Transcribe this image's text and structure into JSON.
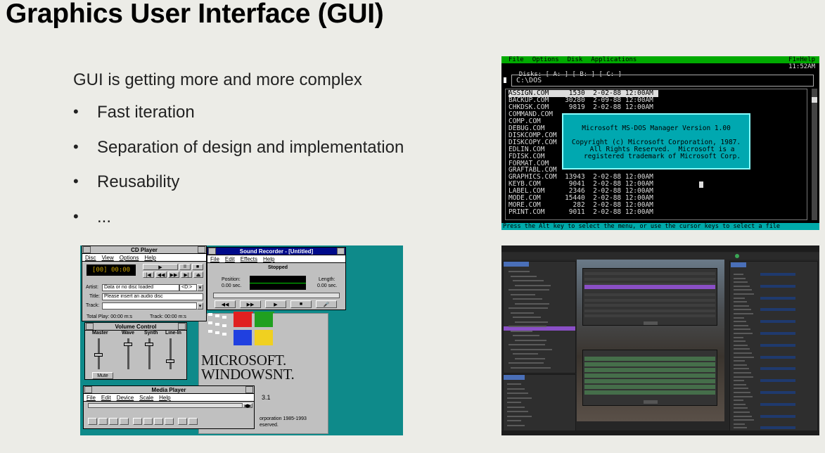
{
  "slide": {
    "title": "Graphics User Interface (GUI)",
    "intro": "GUI is getting more and more complex",
    "bullets": [
      "Fast iteration",
      "Separation of design and implementation",
      "Reusability",
      "..."
    ]
  },
  "win31": {
    "cd_player": {
      "title": "CD Player",
      "menu": [
        "Disc",
        "View",
        "Options",
        "Help"
      ],
      "display": "[00] 00:00",
      "artist_label": "Artist:",
      "artist_value": "Data or no disc loaded",
      "drive": "<D:>",
      "title_label": "Title:",
      "title_value": "Please insert an audio disc",
      "track_label": "Track:",
      "total_play": "Total Play: 00:00 m:s",
      "track_time": "Track: 00:00 m:s"
    },
    "sound_recorder": {
      "title": "Sound Recorder - [Untitled]",
      "menu": [
        "File",
        "Edit",
        "Effects",
        "Help"
      ],
      "status": "Stopped",
      "position_label": "Position:",
      "position_value": "0.00 sec.",
      "length_label": "Length:",
      "length_value": "0.00 sec.",
      "buttons": [
        "◀◀",
        "▶▶",
        "▶",
        "■",
        "🎤"
      ]
    },
    "volume_control": {
      "title": "Volume Control",
      "channels": [
        "Master",
        "Wave",
        "Synth",
        "Line-In"
      ],
      "levels": [
        0.45,
        0.85,
        0.85,
        0.2
      ],
      "mute_label": "Mute"
    },
    "media_player": {
      "title": "Media Player",
      "menu": [
        "File",
        "Edit",
        "Device",
        "Scale",
        "Help"
      ]
    },
    "logo": {
      "line1": "Microsoft.",
      "line2": "WindowsNT.",
      "version": "3.1",
      "copyright_1": "orporation 1985-1993",
      "copyright_2": "eserved."
    },
    "colors": {
      "desktop": "#0e8a8a",
      "titlebar_active": "#000a8a"
    }
  },
  "dos": {
    "menu": [
      "File",
      "Options",
      "Disk",
      "Applications"
    ],
    "help": "F1=Help",
    "disks": "Disks: [ A: ] [ B: ] [ C: ]",
    "clock": "11:52AM",
    "path": "C:\\DOS",
    "files": [
      {
        "name": "ASSIGN.COM",
        "size": "1530",
        "date": "2-02-88",
        "time": "12:00AM"
      },
      {
        "name": "BACKUP.COM",
        "size": "30280",
        "date": "2-09-88",
        "time": "12:00AM"
      },
      {
        "name": "CHKDSK.COM",
        "size": "9819",
        "date": "2-02-88",
        "time": "12:00AM"
      },
      {
        "name": "COMMAND.COM",
        "size": "",
        "date": "",
        "time": ""
      },
      {
        "name": "COMP.COM",
        "size": "",
        "date": "",
        "time": ""
      },
      {
        "name": "DEBUG.COM",
        "size": "",
        "date": "",
        "time": ""
      },
      {
        "name": "DISKCOMP.COM",
        "size": "",
        "date": "",
        "time": ""
      },
      {
        "name": "DISKCOPY.COM",
        "size": "",
        "date": "",
        "time": ""
      },
      {
        "name": "EDLIN.COM",
        "size": "",
        "date": "",
        "time": ""
      },
      {
        "name": "FDISK.COM",
        "size": "",
        "date": "",
        "time": ""
      },
      {
        "name": "FORMAT.COM",
        "size": "",
        "date": "",
        "time": ""
      },
      {
        "name": "GRAFTABL.COM",
        "size": "",
        "date": "",
        "time": ""
      },
      {
        "name": "GRAPHICS.COM",
        "size": "13943",
        "date": "2-02-88",
        "time": "12:00AM"
      },
      {
        "name": "KEYB.COM",
        "size": "9041",
        "date": "2-02-88",
        "time": "12:00AM"
      },
      {
        "name": "LABEL.COM",
        "size": "2346",
        "date": "2-02-88",
        "time": "12:00AM"
      },
      {
        "name": "MODE.COM",
        "size": "15440",
        "date": "2-02-88",
        "time": "12:00AM"
      },
      {
        "name": "MORE.COM",
        "size": "282",
        "date": "2-02-88",
        "time": "12:00AM"
      },
      {
        "name": "PRINT.COM",
        "size": "9011",
        "date": "2-02-88",
        "time": "12:00AM"
      }
    ],
    "dialog": {
      "title": "Microsoft MS-DOS Manager Version 1.00",
      "copyright": "Copyright (c) Microsoft Corporation, 1987.\n   All Rights Reserved.  Microsoft is a\n   registered trademark of Microsoft Corp."
    },
    "status": "Press the Alt key to select the menu, or use the cursor keys to select a file",
    "colors": {
      "menu": "#00aa00",
      "dialog": "#00a8b0",
      "status": "#00aaaa"
    }
  },
  "editor": {
    "colors": {
      "background": "#262626",
      "selection": "#8a4fc6",
      "row_highlight": "#456e4a",
      "accent": "#4a6fb8"
    }
  }
}
